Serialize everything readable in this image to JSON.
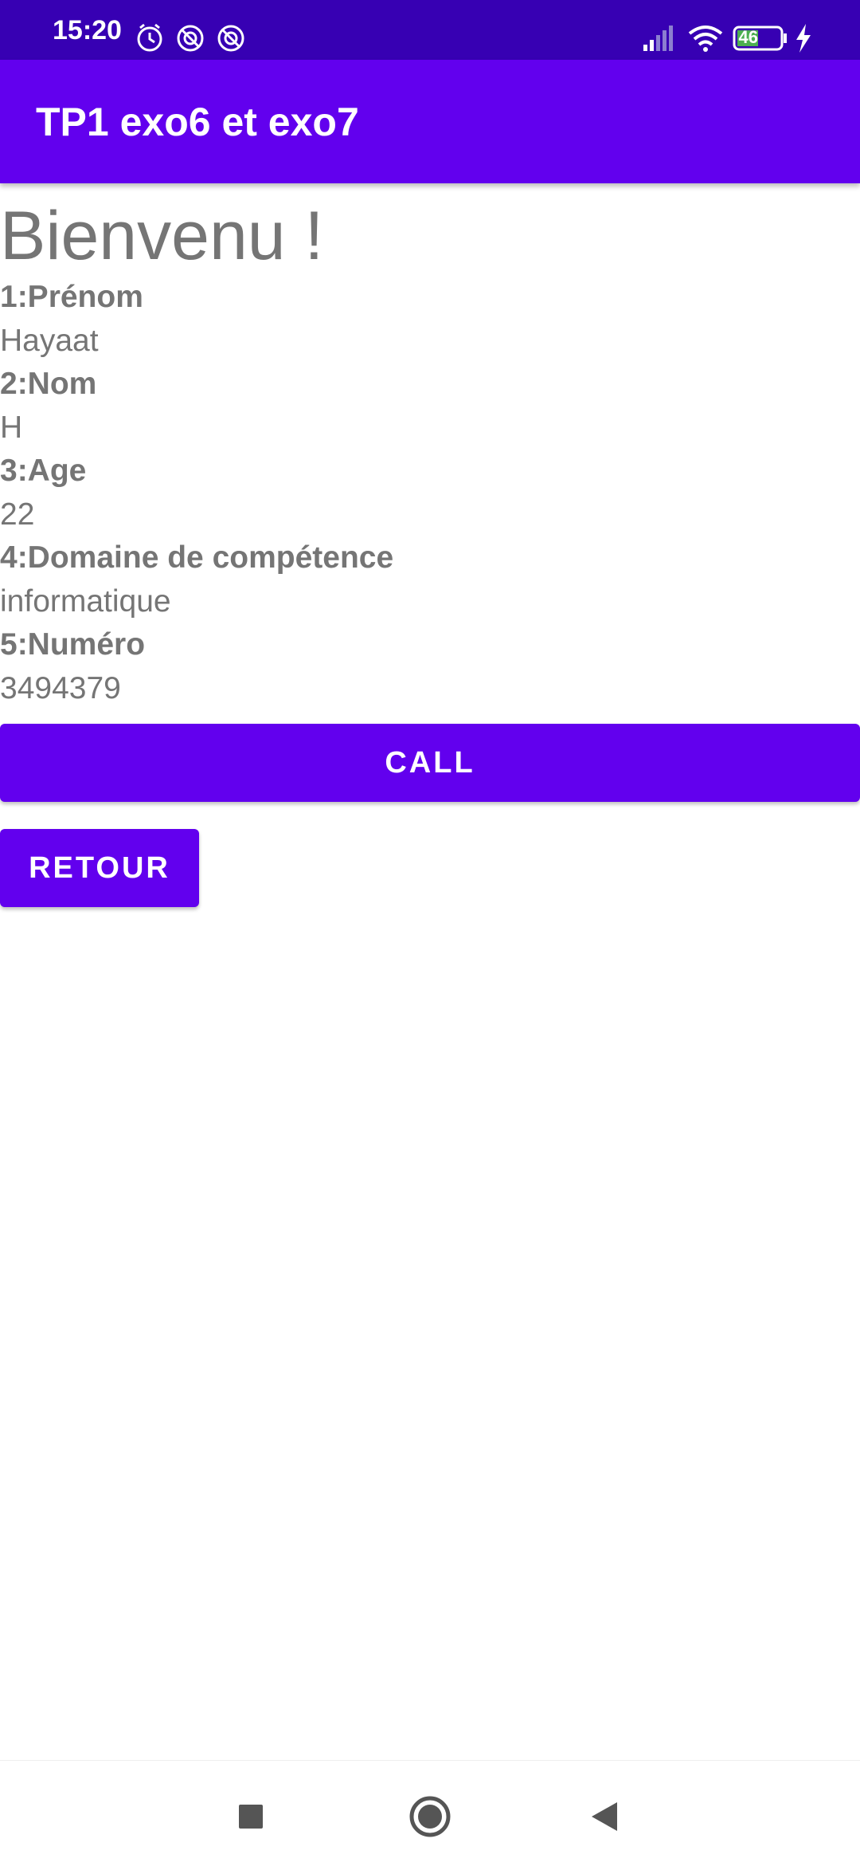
{
  "status_bar": {
    "time": "15:20",
    "battery_level": "46",
    "icons_left": [
      "alarm-icon",
      "sync-icon",
      "sync-icon"
    ],
    "icons_right": [
      "signal-icon",
      "wifi-icon",
      "battery-icon",
      "charging-icon"
    ],
    "background_color": "#3700b3"
  },
  "app_bar": {
    "title": "TP1 exo6 et exo7",
    "background_color": "#6200ee"
  },
  "main": {
    "welcome": "Bienvenu !",
    "fields": [
      {
        "label": "1:Prénom",
        "value": "Hayaat"
      },
      {
        "label": "2:Nom",
        "value": "H"
      },
      {
        "label": "3:Age",
        "value": "22"
      },
      {
        "label": "4:Domaine de compétence",
        "value": "informatique"
      },
      {
        "label": "5:Numéro",
        "value": "3494379"
      }
    ],
    "call_button": "CALL",
    "back_button": "RETOUR",
    "accent_color": "#6200ee"
  },
  "nav_bar": {
    "items": [
      "recents-square-icon",
      "home-circle-icon",
      "back-triangle-icon"
    ]
  }
}
